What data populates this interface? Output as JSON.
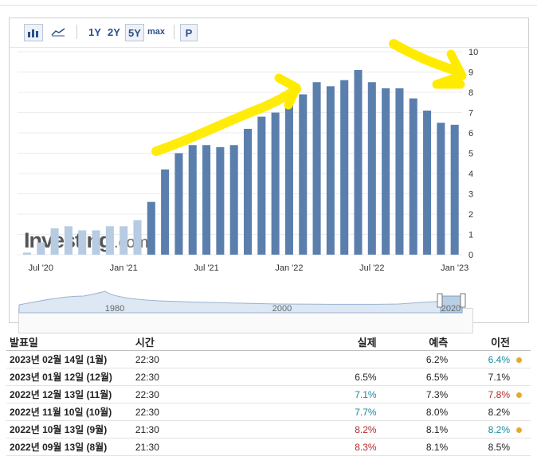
{
  "toolbar": {
    "bar_icon": "bar-chart-icon",
    "area_icon": "area-chart-icon",
    "ranges": [
      "1Y",
      "2Y",
      "5Y",
      "max"
    ],
    "selected_range": "5Y",
    "p_label": "P"
  },
  "watermark": "Investing.com",
  "chart_data": {
    "type": "bar",
    "categories": [
      "Jun '20",
      "Jul '20",
      "Aug '20",
      "Sep '20",
      "Oct '20",
      "Nov '20",
      "Dec '20",
      "Jan '21",
      "Feb '21",
      "Mar '21",
      "Apr '21",
      "May '21",
      "Jun '21",
      "Jul '21",
      "Aug '21",
      "Sep '21",
      "Oct '21",
      "Nov '21",
      "Dec '21",
      "Jan '22",
      "Feb '22",
      "Mar '22",
      "Apr '22",
      "May '22",
      "Jun '22",
      "Jul '22",
      "Aug '22",
      "Sep '22",
      "Oct '22",
      "Nov '22",
      "Dec '22",
      "Jan '23"
    ],
    "values": [
      0.1,
      0.6,
      1.3,
      1.4,
      1.2,
      1.2,
      1.4,
      1.4,
      1.7,
      2.6,
      4.2,
      5.0,
      5.4,
      5.4,
      5.3,
      5.4,
      6.2,
      6.8,
      7.0,
      7.5,
      7.9,
      8.5,
      8.3,
      8.6,
      9.1,
      8.5,
      8.2,
      8.2,
      7.7,
      7.1,
      6.5,
      6.4
    ],
    "faded_count": 9,
    "x_tick_labels": [
      "Jul '20",
      "Jan '21",
      "Jul '21",
      "Jan '22",
      "Jul '22",
      "Jan '23"
    ],
    "y_ticks": [
      0,
      1,
      2,
      3,
      4,
      5,
      6,
      7,
      8,
      9,
      10
    ],
    "ylim": [
      0,
      10
    ],
    "navigator_labels": [
      "1980",
      "2000",
      "2020"
    ],
    "colors": {
      "bar": "#5b7fad",
      "faded_bar": "#b7cbe2",
      "highlight": "#ffeb00"
    }
  },
  "table": {
    "headers": [
      "발표일",
      "시간",
      "실제",
      "예측",
      "이전"
    ],
    "rows": [
      {
        "date": "2023년 02월 14일 (1월)",
        "time": "22:30",
        "actual": "",
        "forecast": "6.2%",
        "previous": "6.4%",
        "prev_dir": "down",
        "dot": true
      },
      {
        "date": "2023년 01월 12일 (12월)",
        "time": "22:30",
        "actual": "6.5%",
        "forecast": "6.5%",
        "previous": "7.1%",
        "act_dir": "",
        "prev_dir": "",
        "dot": false
      },
      {
        "date": "2022년 12월 13일 (11월)",
        "time": "22:30",
        "actual": "7.1%",
        "forecast": "7.3%",
        "previous": "7.8%",
        "act_dir": "down",
        "prev_dir": "up",
        "dot": true
      },
      {
        "date": "2022년 11월 10일 (10월)",
        "time": "22:30",
        "actual": "7.7%",
        "forecast": "8.0%",
        "previous": "8.2%",
        "act_dir": "down",
        "prev_dir": "",
        "dot": false
      },
      {
        "date": "2022년 10월 13일 (9월)",
        "time": "21:30",
        "actual": "8.2%",
        "forecast": "8.1%",
        "previous": "8.2%",
        "act_dir": "up",
        "prev_dir": "down",
        "dot": true
      },
      {
        "date": "2022년 09월 13일 (8월)",
        "time": "21:30",
        "actual": "8.3%",
        "forecast": "8.1%",
        "previous": "8.5%",
        "act_dir": "up",
        "prev_dir": "",
        "dot": false
      }
    ]
  }
}
